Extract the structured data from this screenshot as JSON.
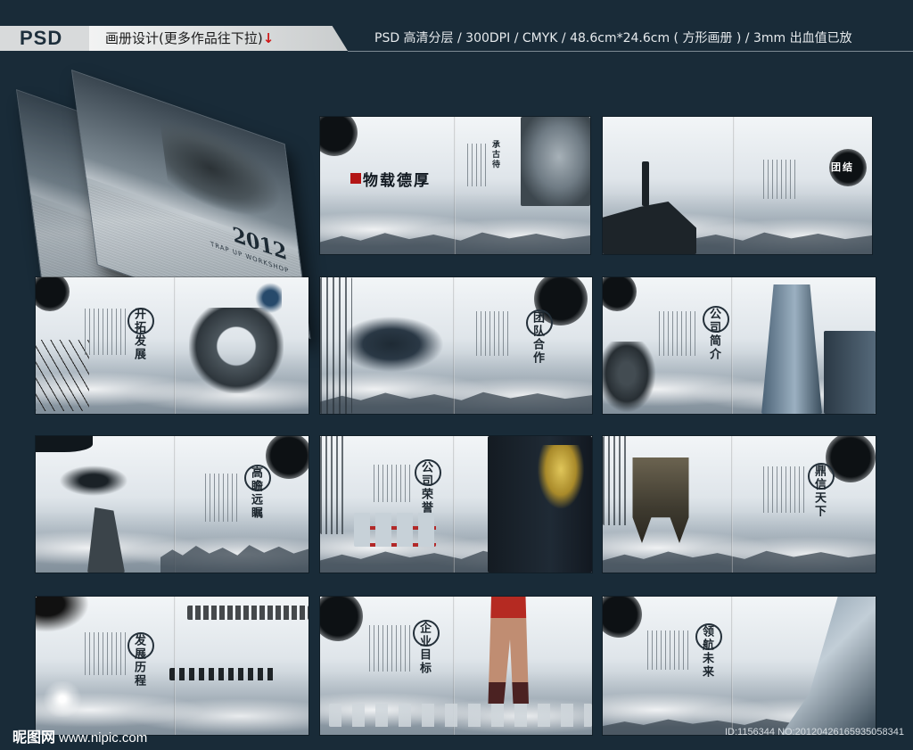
{
  "header": {
    "badge": "PSD",
    "title": "画册设计(更多作品往下拉)",
    "title_arrow": "↓",
    "specs": "PSD 高清分层  /  300DPI  /  CMYK  /  48.6cm*24.6cm ( 方形画册 )  /  3mm 出血值已放"
  },
  "cover": {
    "year": "2012",
    "subtitle": "TRAP UP WORKSHOP"
  },
  "spreads": [
    {
      "title": "物载德厚",
      "side_title": "承古待"
    },
    {
      "title": "团结",
      "side_title": ""
    },
    {
      "title": "开拓发展",
      "side_title": ""
    },
    {
      "title": "团队合作",
      "side_title": ""
    },
    {
      "title": "公司简介",
      "side_title": ""
    },
    {
      "title": "高瞻远瞩",
      "side_title": ""
    },
    {
      "title": "公司荣誉",
      "side_title": ""
    },
    {
      "title": "鼎信天下",
      "side_title": ""
    },
    {
      "title": "发展历程",
      "side_title": ""
    },
    {
      "title": "企业目标",
      "side_title": ""
    },
    {
      "title": "领航未来",
      "side_title": ""
    }
  ],
  "footer": {
    "logo": "昵图网",
    "url": "www.nipic.com",
    "id": "ID:1156344 NO:20120426165935058341"
  },
  "colors": {
    "background": "#192b38",
    "accent_red": "#b31515"
  }
}
